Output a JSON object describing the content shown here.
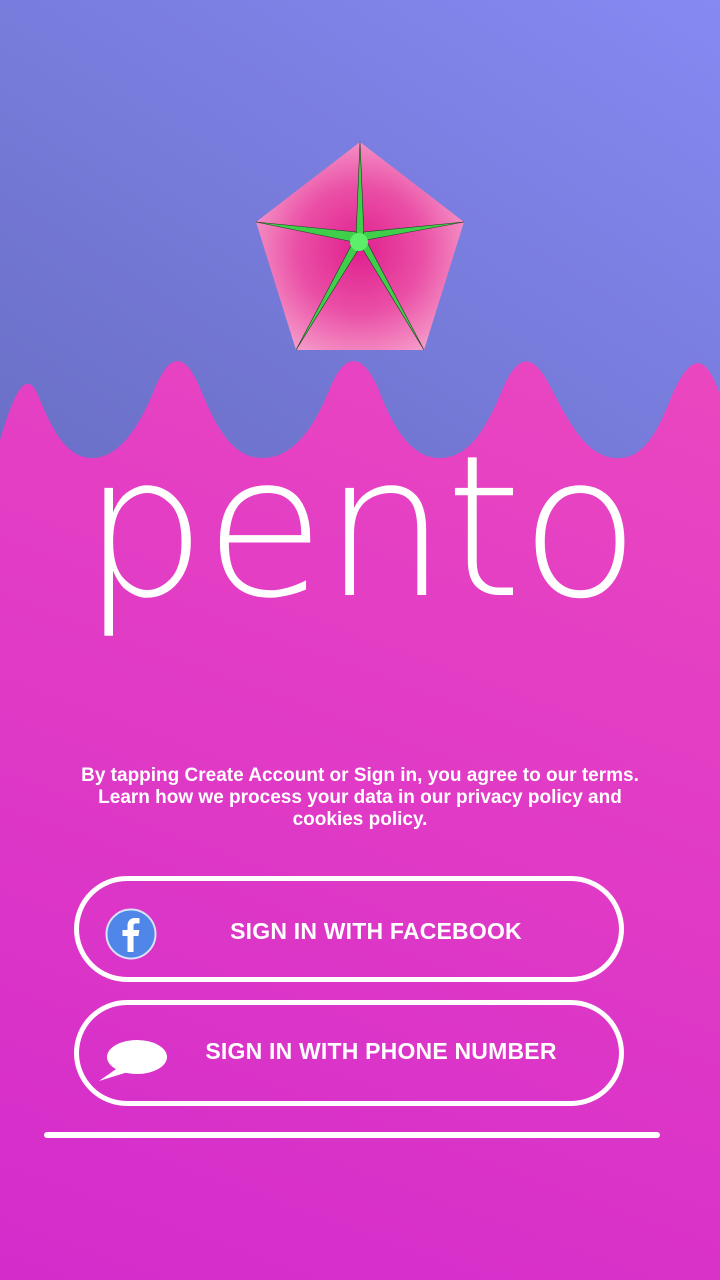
{
  "app": {
    "name": "pento",
    "logo_icon": "pentagon-star-logo"
  },
  "colors": {
    "top_gradient_start": "#6a6fc6",
    "top_gradient_end": "#8689f2",
    "bottom_gradient_start": "#f24fbb",
    "bottom_gradient_end": "#d42ccb",
    "logo_pink": "#e8389e",
    "logo_star_green": "#3fe04c",
    "facebook_blue": "#4f86e8"
  },
  "terms": {
    "text": "By tapping Create Account or Sign in, you agree to our terms. Learn how we process your data in our privacy policy and cookies policy."
  },
  "buttons": {
    "facebook": {
      "label": "SIGN IN WITH FACEBOOK",
      "icon": "facebook-icon"
    },
    "phone": {
      "label": "SIGN IN WITH PHONE NUMBER",
      "icon": "chat-bubble-icon"
    }
  }
}
